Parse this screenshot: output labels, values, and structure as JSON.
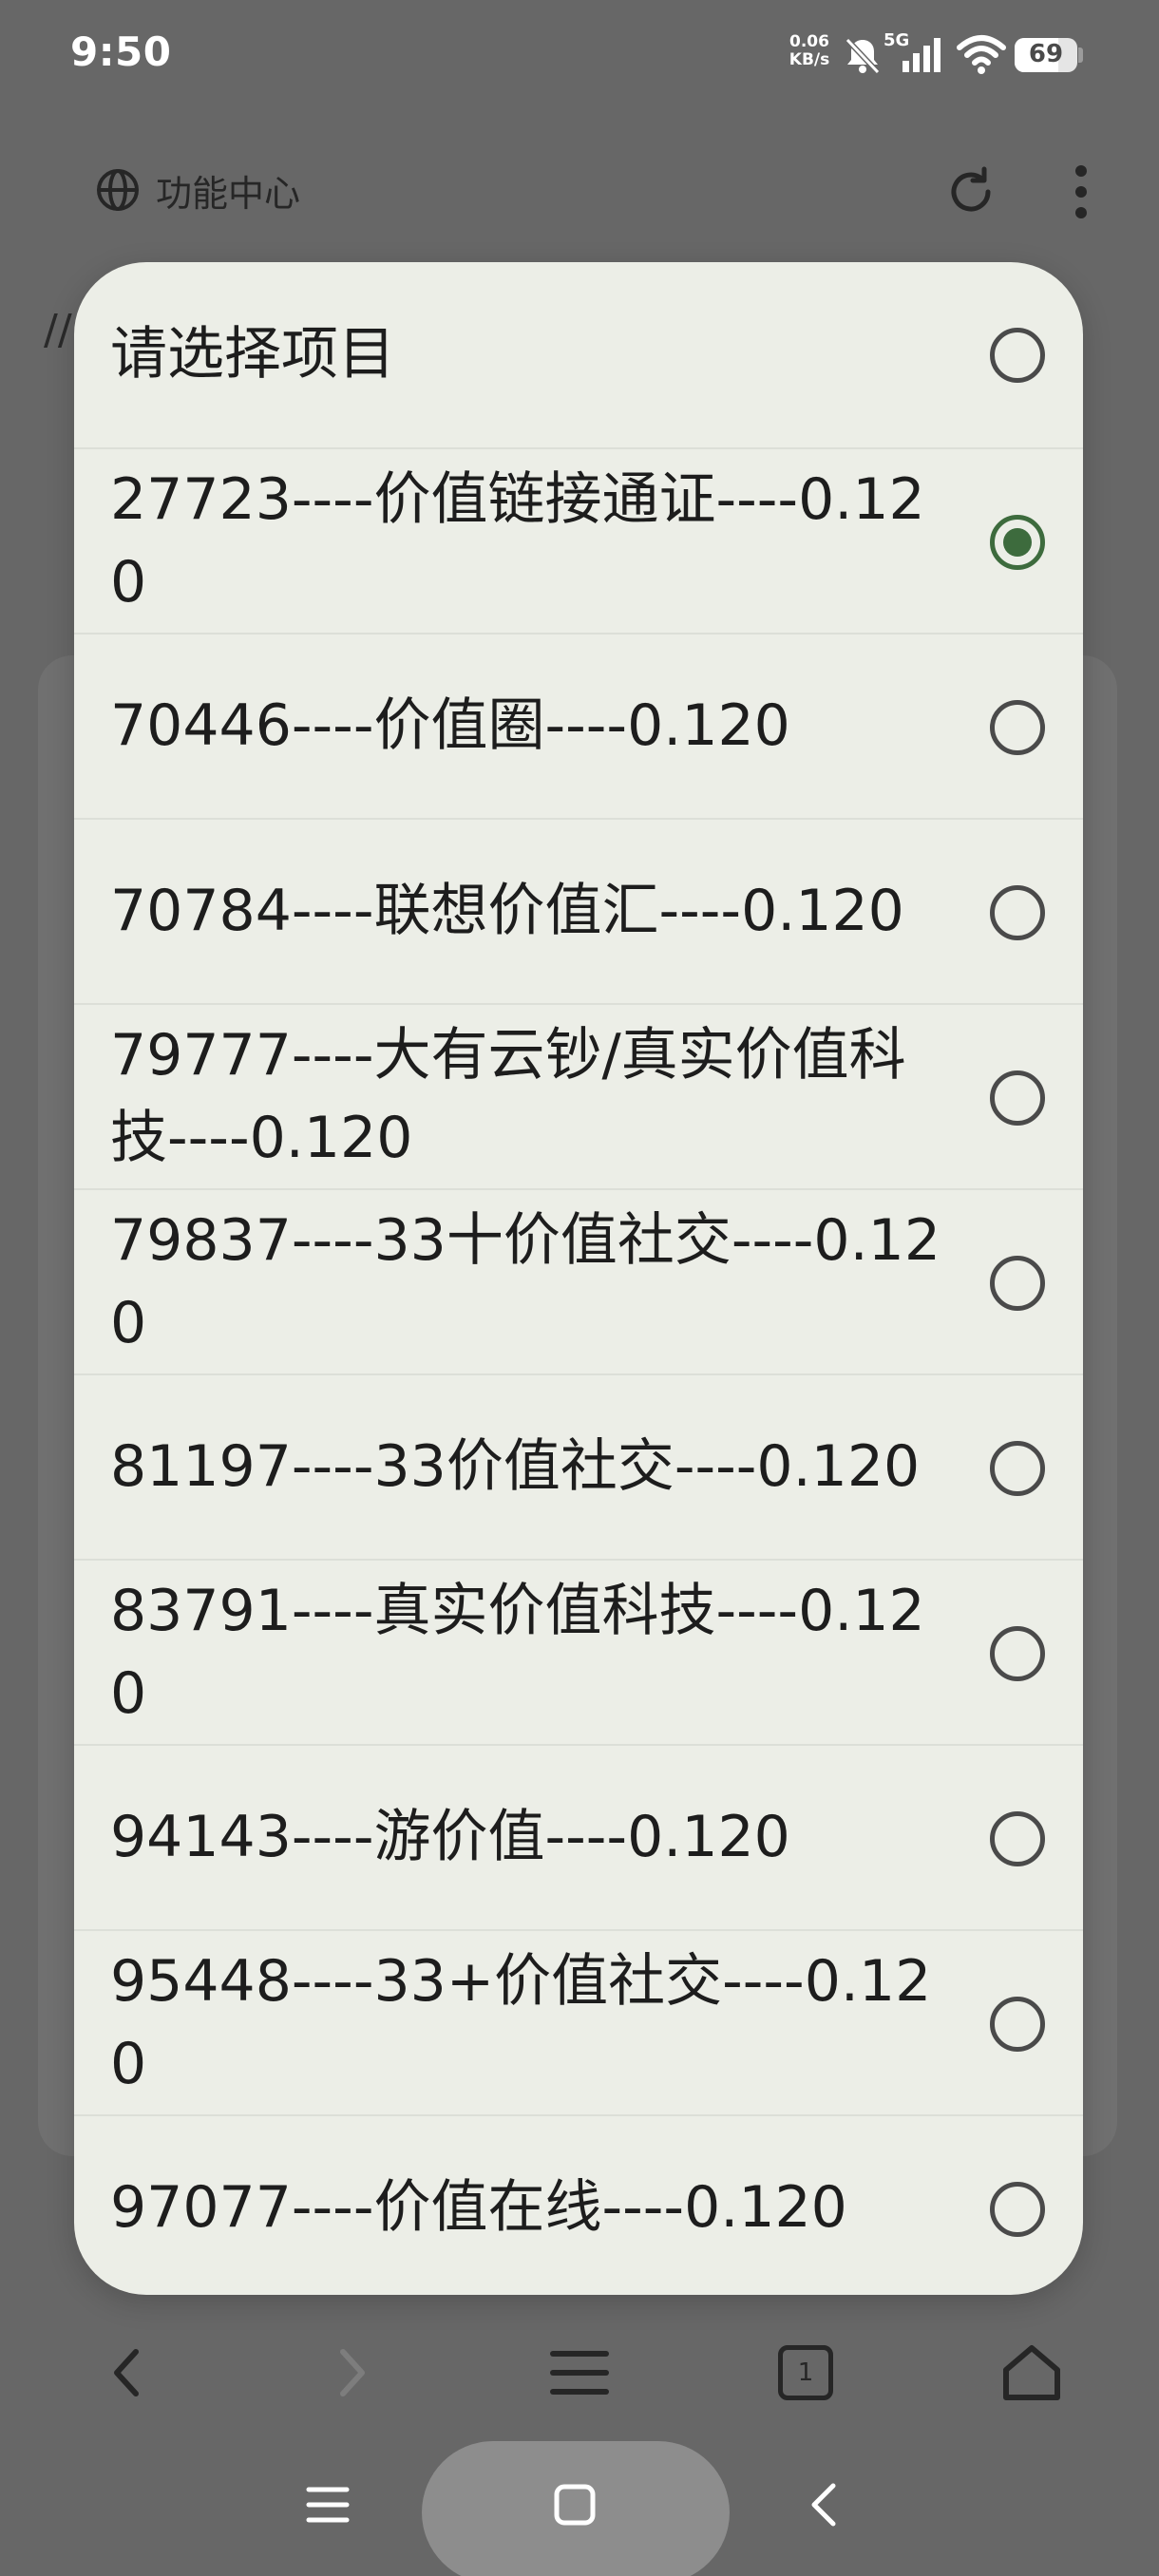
{
  "status_bar": {
    "time": "9:50",
    "net_speed_value": "0.06",
    "net_speed_unit": "KB/s",
    "network_type": "5G",
    "battery_level": "69"
  },
  "app_header": {
    "title": "功能中心",
    "background_text": "//"
  },
  "dialog": {
    "options": [
      {
        "label": "请选择项目",
        "selected": false
      },
      {
        "label": "27723----价值链接通证----0.120",
        "selected": true
      },
      {
        "label": "70446----价值圈----0.120",
        "selected": false
      },
      {
        "label": "70784----联想价值汇----0.120",
        "selected": false
      },
      {
        "label": "79777----大有云钞/真实价值科技----0.120",
        "selected": false
      },
      {
        "label": "79837----33十价值社交----0.120",
        "selected": false
      },
      {
        "label": "81197----33价值社交----0.120",
        "selected": false
      },
      {
        "label": "83791----真实价值科技----0.120",
        "selected": false
      },
      {
        "label": "94143----游价值----0.120",
        "selected": false
      },
      {
        "label": "95448----33+价值社交----0.120",
        "selected": false
      },
      {
        "label": "97077----价值在线----0.120",
        "selected": false
      }
    ]
  },
  "bottom_toolbar": {
    "tab_count": "1"
  },
  "icons": {
    "globe": "globe-icon",
    "refresh": "refresh-icon",
    "more": "more-vertical-icon",
    "back": "chevron-left-icon",
    "forward": "chevron-right-icon",
    "menu": "menu-icon",
    "tabs": "tabs-icon",
    "home": "home-icon"
  },
  "colors": {
    "radio_selected": "#3d6b3d",
    "dialog_bg": "#eceee7",
    "scrim": "#676767"
  }
}
